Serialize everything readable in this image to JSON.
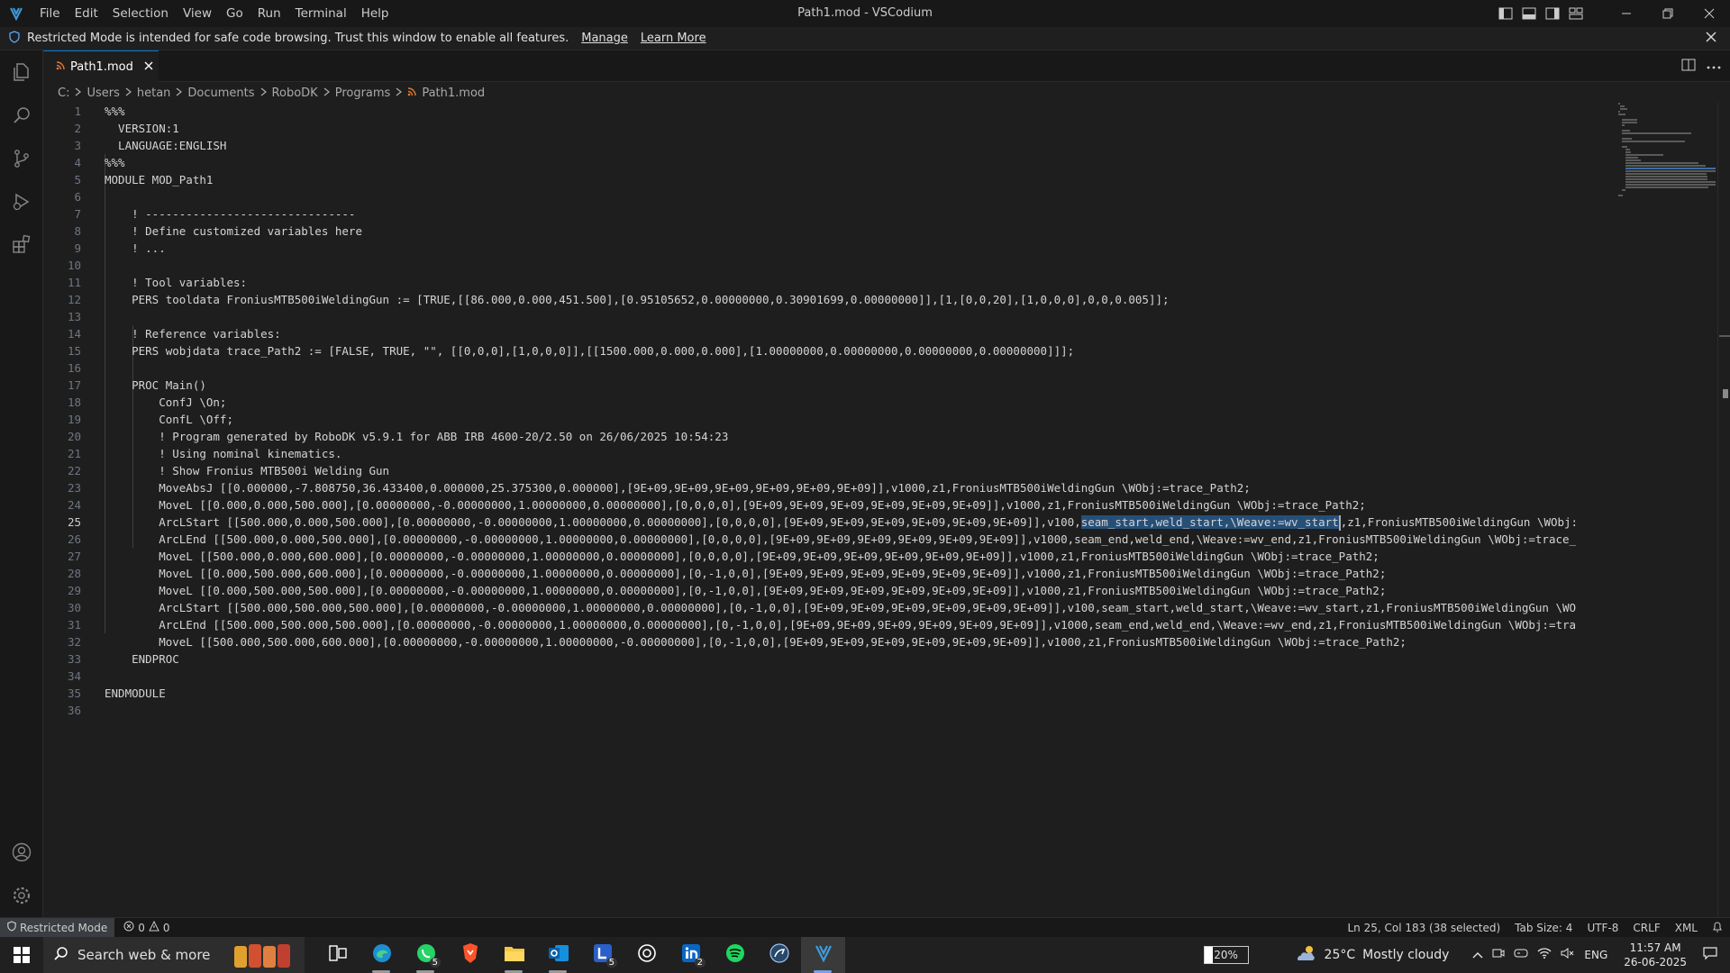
{
  "titlebar": {
    "menu": [
      "File",
      "Edit",
      "Selection",
      "View",
      "Go",
      "Run",
      "Terminal",
      "Help"
    ],
    "title": "Path1.mod - VSCodium"
  },
  "banner": {
    "text": "Restricted Mode is intended for safe code browsing. Trust this window to enable all features.",
    "manage": "Manage",
    "learn_more": "Learn More"
  },
  "tab": {
    "label": "Path1.mod"
  },
  "breadcrumb": [
    "C:",
    "Users",
    "hetan",
    "Documents",
    "RoboDK",
    "Programs",
    "Path1.mod"
  ],
  "editor": {
    "active_line": 25,
    "selection": "seam_start,weld_start,\\Weave:=wv_start",
    "lines": [
      "%%%",
      "  VERSION:1",
      "  LANGUAGE:ENGLISH",
      "%%%",
      "MODULE MOD_Path1",
      "",
      "    ! -------------------------------",
      "    ! Define customized variables here",
      "    ! ...",
      "",
      "    ! Tool variables:",
      "    PERS tooldata FroniusMTB500iWeldingGun := [TRUE,[[86.000,0.000,451.500],[0.95105652,0.00000000,0.30901699,0.00000000]],[1,[0,0,20],[1,0,0,0],0,0,0.005]];",
      "",
      "    ! Reference variables:",
      "    PERS wobjdata trace_Path2 := [FALSE, TRUE, \"\", [[0,0,0],[1,0,0,0]],[[1500.000,0.000,0.000],[1.00000000,0.00000000,0.00000000,0.00000000]]];",
      "",
      "    PROC Main()",
      "        ConfJ \\On;",
      "        ConfL \\Off;",
      "        ! Program generated by RoboDK v5.9.1 for ABB IRB 4600-20/2.50 on 26/06/2025 10:54:23",
      "        ! Using nominal kinematics.",
      "        ! Show Fronius MTB500i Welding Gun",
      "        MoveAbsJ [[0.000000,-7.808750,36.433400,0.000000,25.375300,0.000000],[9E+09,9E+09,9E+09,9E+09,9E+09,9E+09]],v1000,z1,FroniusMTB500iWeldingGun \\WObj:=trace_Path2;",
      "        MoveL [[0.000,0.000,500.000],[0.00000000,-0.00000000,1.00000000,0.00000000],[0,0,0,0],[9E+09,9E+09,9E+09,9E+09,9E+09,9E+09]],v1000,z1,FroniusMTB500iWeldingGun \\WObj:=trace_Path2;",
      "        ArcLStart [[500.000,0.000,500.000],[0.00000000,-0.00000000,1.00000000,0.00000000],[0,0,0,0],[9E+09,9E+09,9E+09,9E+09,9E+09,9E+09]],v100,seam_start,weld_start,\\Weave:=wv_start,z1,FroniusMTB500iWeldingGun \\WObj:",
      "        ArcLEnd [[500.000,0.000,500.000],[0.00000000,-0.00000000,1.00000000,0.00000000],[0,0,0,0],[9E+09,9E+09,9E+09,9E+09,9E+09,9E+09]],v1000,seam_end,weld_end,\\Weave:=wv_end,z1,FroniusMTB500iWeldingGun \\WObj:=trace_",
      "        MoveL [[500.000,0.000,600.000],[0.00000000,-0.00000000,1.00000000,0.00000000],[0,0,0,0],[9E+09,9E+09,9E+09,9E+09,9E+09,9E+09]],v1000,z1,FroniusMTB500iWeldingGun \\WObj:=trace_Path2;",
      "        MoveL [[0.000,500.000,600.000],[0.00000000,-0.00000000,1.00000000,0.00000000],[0,-1,0,0],[9E+09,9E+09,9E+09,9E+09,9E+09,9E+09]],v1000,z1,FroniusMTB500iWeldingGun \\WObj:=trace_Path2;",
      "        MoveL [[0.000,500.000,500.000],[0.00000000,-0.00000000,1.00000000,0.00000000],[0,-1,0,0],[9E+09,9E+09,9E+09,9E+09,9E+09,9E+09]],v1000,z1,FroniusMTB500iWeldingGun \\WObj:=trace_Path2;",
      "        ArcLStart [[500.000,500.000,500.000],[0.00000000,-0.00000000,1.00000000,0.00000000],[0,-1,0,0],[9E+09,9E+09,9E+09,9E+09,9E+09,9E+09]],v100,seam_start,weld_start,\\Weave:=wv_start,z1,FroniusMTB500iWeldingGun \\WO",
      "        ArcLEnd [[500.000,500.000,500.000],[0.00000000,-0.00000000,1.00000000,0.00000000],[0,-1,0,0],[9E+09,9E+09,9E+09,9E+09,9E+09,9E+09]],v1000,seam_end,weld_end,\\Weave:=wv_end,z1,FroniusMTB500iWeldingGun \\WObj:=tra",
      "        MoveL [[500.000,500.000,600.000],[0.00000000,-0.00000000,1.00000000,-0.00000000],[0,-1,0,0],[9E+09,9E+09,9E+09,9E+09,9E+09,9E+09]],v1000,z1,FroniusMTB500iWeldingGun \\WObj:=trace_Path2;",
      "    ENDPROC",
      "",
      "ENDMODULE",
      ""
    ]
  },
  "statusbar": {
    "restricted": "Restricted Mode",
    "errors": "0",
    "warnings": "0",
    "position": "Ln 25, Col 183 (38 selected)",
    "tab_size": "Tab Size: 4",
    "encoding": "UTF-8",
    "eol": "CRLF",
    "language": "XML"
  },
  "taskbar": {
    "search": "Search web & more",
    "apps": [
      {
        "name": "task-view",
        "badge": ""
      },
      {
        "name": "edge",
        "badge": ""
      },
      {
        "name": "whatsapp",
        "badge": "5"
      },
      {
        "name": "brave",
        "badge": ""
      },
      {
        "name": "file-explorer",
        "badge": ""
      },
      {
        "name": "outlook",
        "badge": ""
      },
      {
        "name": "lexi",
        "badge": "5"
      },
      {
        "name": "chatgpt",
        "badge": ""
      },
      {
        "name": "linkedin",
        "badge": "2"
      },
      {
        "name": "spotify",
        "badge": ""
      },
      {
        "name": "robodk",
        "badge": ""
      },
      {
        "name": "vscodium",
        "badge": ""
      }
    ],
    "battery": "20%",
    "battery_level": 0.2,
    "temperature": "25°C",
    "weather": "Mostly cloudy",
    "language": "ENG",
    "time": "11:57 AM",
    "date": "26-06-2025"
  },
  "colors": {
    "accent": "#0078d4",
    "selection": "#264f78",
    "editor_bg": "#1e1e1e",
    "chrome_bg": "#181818"
  }
}
